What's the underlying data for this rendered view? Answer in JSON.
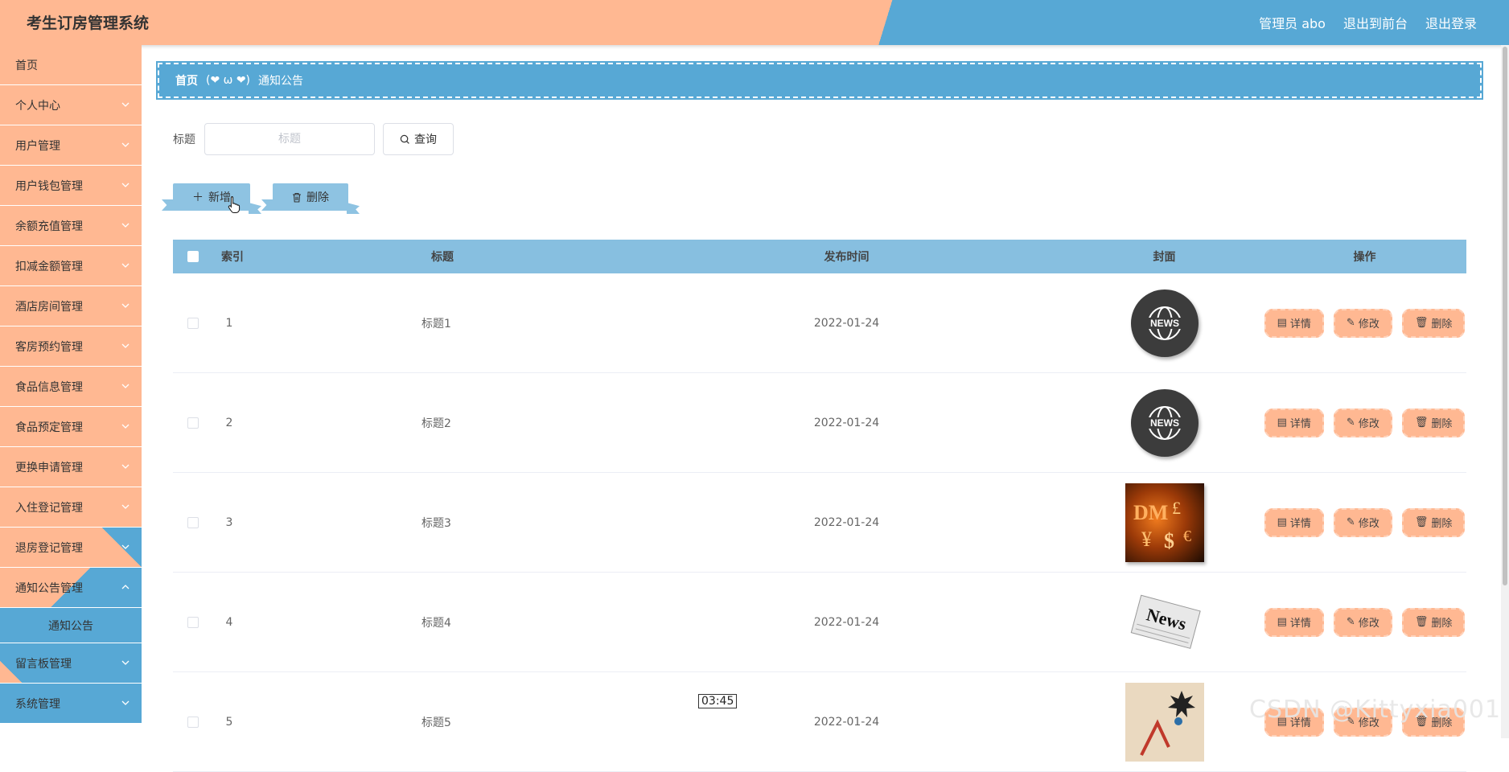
{
  "header": {
    "title": "考生订房管理系统",
    "admin": "管理员 abo",
    "to_front": "退出到前台",
    "logout": "退出登录"
  },
  "sidebar": {
    "items": [
      {
        "label": "首页"
      },
      {
        "label": "个人中心"
      },
      {
        "label": "用户管理"
      },
      {
        "label": "用户钱包管理"
      },
      {
        "label": "余额充值管理"
      },
      {
        "label": "扣减金额管理"
      },
      {
        "label": "酒店房间管理"
      },
      {
        "label": "客房预约管理"
      },
      {
        "label": "食品信息管理"
      },
      {
        "label": "食品预定管理"
      },
      {
        "label": "更换申请管理"
      },
      {
        "label": "入住登记管理"
      },
      {
        "label": "退房登记管理"
      },
      {
        "label": "通知公告管理"
      },
      {
        "label": "通知公告"
      },
      {
        "label": "留言板管理"
      },
      {
        "label": "系统管理"
      }
    ]
  },
  "breadcrumb": {
    "home": "首页",
    "separator": "(❤ ω ❤)",
    "current": "通知公告"
  },
  "search": {
    "label": "标题",
    "placeholder": "标题",
    "query_button": "查询"
  },
  "actions": {
    "add": "新增",
    "delete": "删除"
  },
  "table": {
    "headers": {
      "index": "索引",
      "title": "标题",
      "time": "发布时间",
      "cover": "封面",
      "ops": "操作"
    },
    "rows": [
      {
        "index": "1",
        "title": "标题1",
        "time": "2022-01-24"
      },
      {
        "index": "2",
        "title": "标题2",
        "time": "2022-01-24"
      },
      {
        "index": "3",
        "title": "标题3",
        "time": "2022-01-24"
      },
      {
        "index": "4",
        "title": "标题4",
        "time": "2022-01-24"
      },
      {
        "index": "5",
        "title": "标题5",
        "time": "2022-01-24"
      }
    ],
    "op_labels": {
      "detail": "详情",
      "edit": "修改",
      "delete": "删除"
    }
  },
  "overlay": {
    "time_tip": "03:45",
    "watermark": "CSDN @Kittyxia001"
  }
}
